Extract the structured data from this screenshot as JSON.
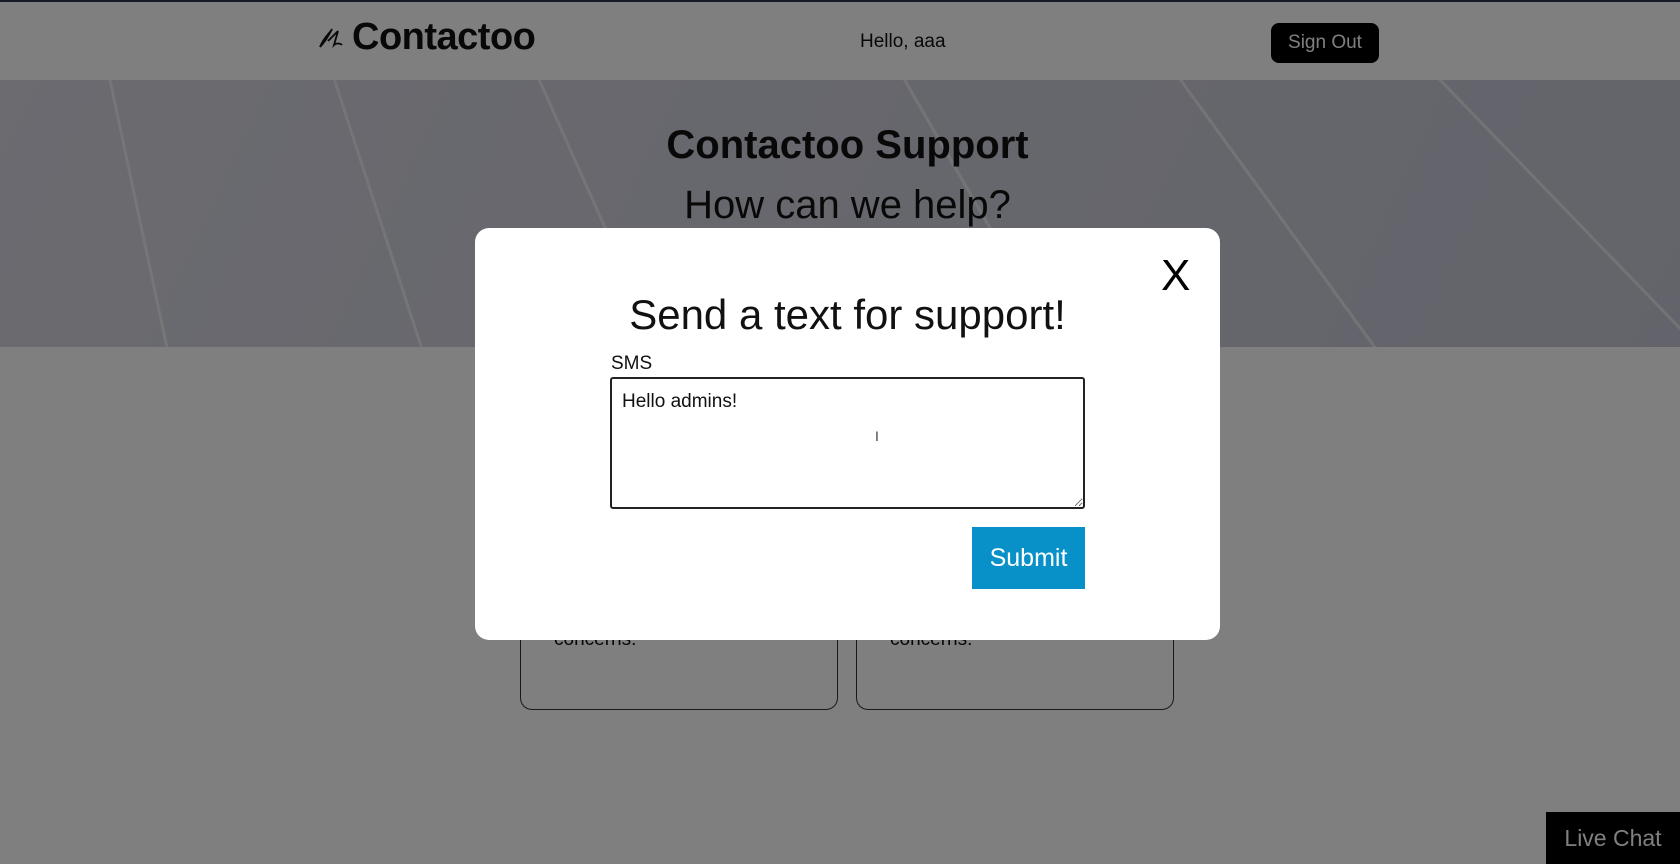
{
  "header": {
    "brand": "Contactoo",
    "greeting": "Hello, aaa",
    "sign_out_label": "Sign Out",
    "logo_icon": "ds-logo-icon"
  },
  "hero": {
    "title": "Contactoo Support",
    "subtitle": "How can we help?"
  },
  "cards": [
    {
      "text": "concerns."
    },
    {
      "text": "concerns."
    }
  ],
  "live_chat_label": "Live Chat",
  "modal": {
    "title": "Send a text for support!",
    "close_label": "X",
    "field_label": "SMS",
    "field_value": "Hello admins!",
    "submit_label": "Submit"
  },
  "colors": {
    "submit": "#0891c9",
    "sign_out": "#000000",
    "overlay": "rgba(0,0,0,0.5)"
  }
}
